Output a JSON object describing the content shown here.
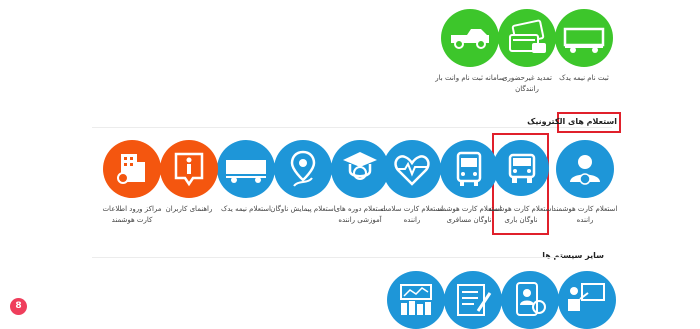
{
  "top_services": [
    {
      "name": "half-plate",
      "label": "ثبت نام نیمه یدک",
      "icon": "trailer-icon"
    },
    {
      "name": "renew-absence",
      "label": "تمدید غیرحضوری رانندگان",
      "icon": "cards-icon"
    },
    {
      "name": "vanet-registration",
      "label": "سامانه ثبت نام وانت بار",
      "icon": "pickup-truck-icon"
    }
  ],
  "inquiry_section": {
    "title": "استعلام های الکترونیک",
    "items": [
      {
        "label": "استعلام کارت هوشمند راننده",
        "icon": "driver-icon",
        "color": "blue"
      },
      {
        "label": "استعلام کارت هوشمند ناوگان باری",
        "icon": "truck-icon",
        "color": "blue"
      },
      {
        "label": "استعلام کارت هوشمند ناوگان مسافری",
        "icon": "bus-icon",
        "color": "blue"
      },
      {
        "label": "استعلام کارت سلامت راننده",
        "icon": "heart-icon",
        "color": "blue"
      },
      {
        "label": "استعلام دوره های آموزشی راننده",
        "icon": "graduate-icon",
        "color": "blue"
      },
      {
        "label": "استعلام پیمایش ناوگان",
        "icon": "route-icon",
        "color": "blue"
      },
      {
        "label": "استعلام نیمه یدک",
        "icon": "trailer-icon",
        "color": "blue"
      },
      {
        "label": "راهنمای کاربران",
        "icon": "info-icon",
        "color": "orange"
      },
      {
        "label": "مراکز ورود اطلاعات کارت هوشمند",
        "icon": "building-location-icon",
        "color": "orange"
      }
    ]
  },
  "other_systems": {
    "title": "سایر سیستم ها",
    "icons": [
      "presentation-icon",
      "tablet-user-icon",
      "checklist-icon",
      "city-chart-icon"
    ]
  },
  "page_badge": "8",
  "colors": {
    "green": "#3dc62b",
    "blue": "#1e96d8",
    "orange": "#f4560f",
    "highlight": "#e0202b"
  }
}
